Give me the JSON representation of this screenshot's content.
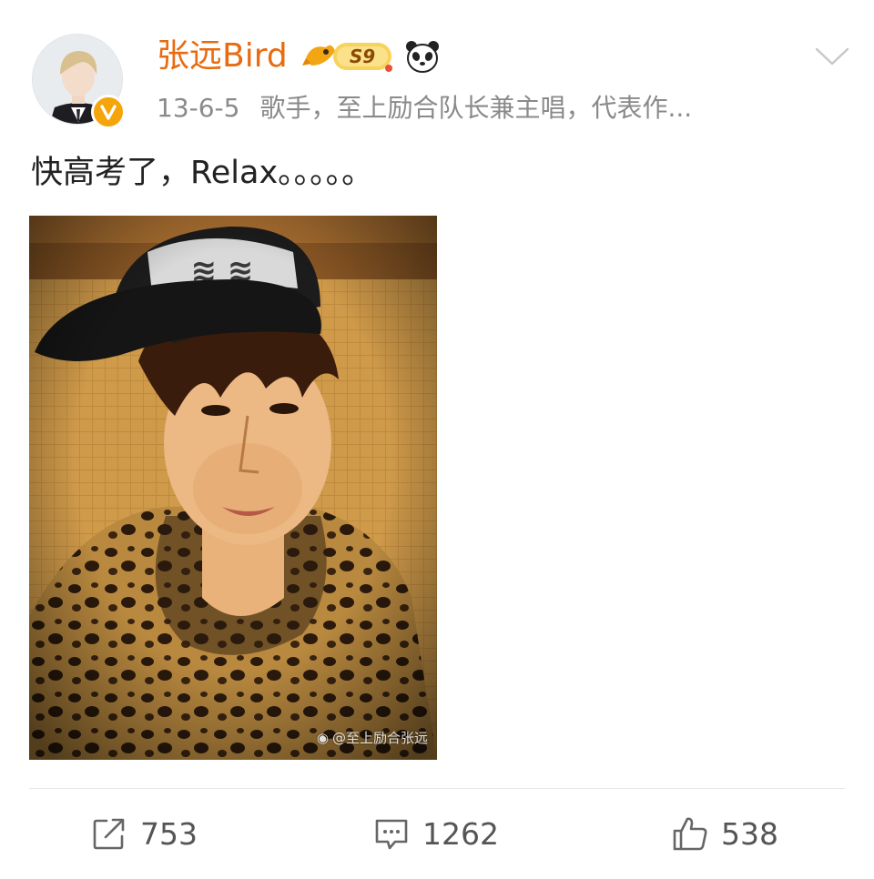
{
  "post": {
    "author": {
      "name": "张远Bird",
      "level_badge": "S9",
      "verified": true
    },
    "date": "13-6-5",
    "bio": "歌手，至上励合队长兼主唱，代表作...",
    "text": "快高考了，Relax。。。。。",
    "image": {
      "watermark": "@至上励合张远"
    }
  },
  "actions": {
    "repost_count": "753",
    "comment_count": "1262",
    "like_count": "538"
  },
  "colors": {
    "username": "#e86b0f",
    "verified_badge": "#f5a40a",
    "meta_text": "#8a8a8a"
  },
  "icons": {
    "more": "chevron-down-icon",
    "repost": "share-arrow-icon",
    "comment": "comment-icon",
    "like": "thumbs-up-icon",
    "verified": "verified-v-icon",
    "level": "level-badge-icon",
    "panda": "panda-icon"
  }
}
